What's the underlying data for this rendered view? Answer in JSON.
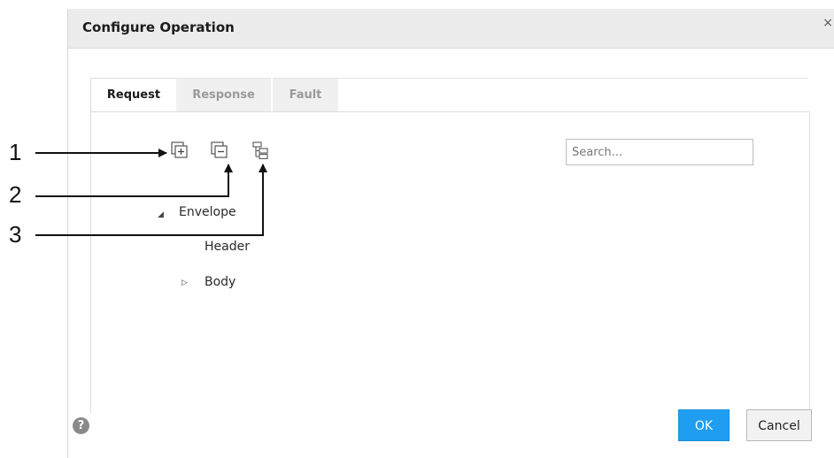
{
  "dialog": {
    "title": "Configure Operation",
    "close_glyph": "×"
  },
  "tabs": [
    {
      "label": "Request",
      "active": true
    },
    {
      "label": "Response",
      "active": false
    },
    {
      "label": "Fault",
      "active": false
    }
  ],
  "toolbar": {
    "icons": [
      "expand-all-icon",
      "collapse-all-icon",
      "hierarchy-icon"
    ]
  },
  "search": {
    "placeholder": "Search..."
  },
  "tree": [
    {
      "label": "Envelope",
      "expander": "expanded"
    },
    {
      "label": "Header",
      "expander": "none"
    },
    {
      "label": "Body",
      "expander": "collapsed"
    }
  ],
  "callouts": [
    "1",
    "2",
    "3"
  ],
  "footer": {
    "ok_label": "OK",
    "cancel_label": "Cancel",
    "help_glyph": "?"
  },
  "colors": {
    "accent": "#1f9df0",
    "titlebar": "#ececec"
  }
}
